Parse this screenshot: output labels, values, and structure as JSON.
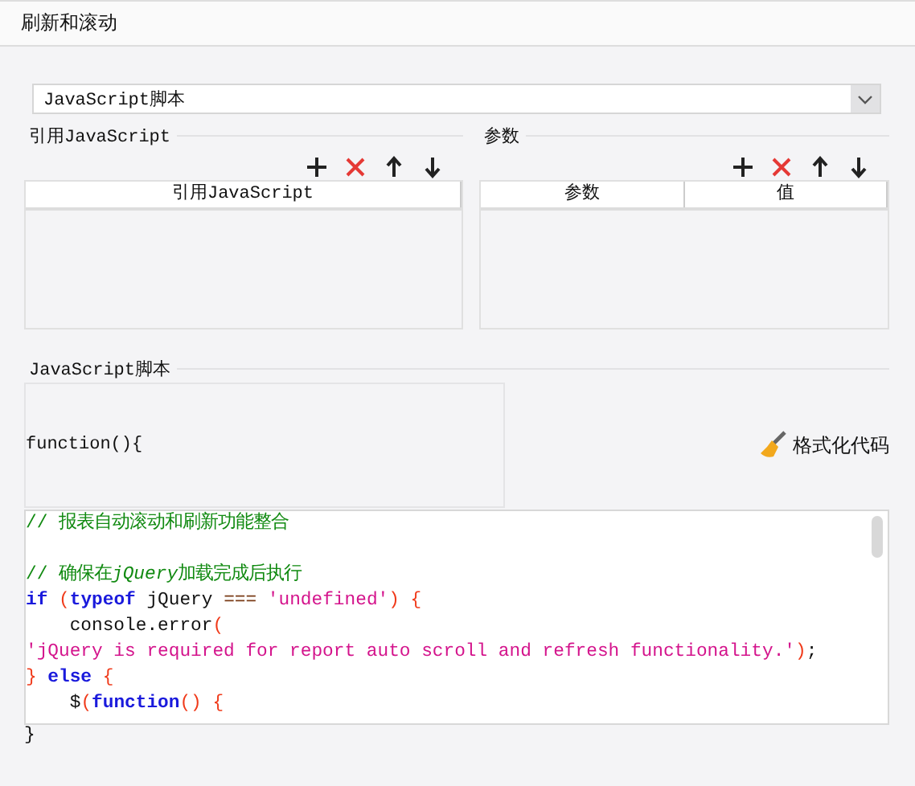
{
  "header": {
    "title": "刷新和滚动"
  },
  "script_type": {
    "value": "JavaScript脚本"
  },
  "references": {
    "title": "引用JavaScript",
    "columns": [
      "引用JavaScript"
    ]
  },
  "parameters": {
    "title": "参数",
    "columns": [
      "参数",
      "值"
    ]
  },
  "script": {
    "title": "JavaScript脚本",
    "signature": "function(){",
    "format_button": "格式化代码",
    "closing": "}",
    "lines": [
      {
        "kind": "code",
        "tokens": [
          {
            "kind": "comment",
            "text": "// 报表自动滚动和刷新功能整合"
          }
        ]
      },
      {
        "kind": "blank"
      },
      {
        "kind": "code",
        "tokens": [
          {
            "kind": "comment",
            "text": "// 确保在"
          },
          {
            "kind": "comment-italic",
            "text": "jQuery"
          },
          {
            "kind": "comment",
            "text": "加载完成后执行"
          }
        ]
      },
      {
        "kind": "code",
        "tokens": [
          {
            "kind": "keyword",
            "text": "if "
          },
          {
            "kind": "punct",
            "text": "("
          },
          {
            "kind": "keyword",
            "text": "typeof "
          },
          {
            "kind": "plain",
            "text": "jQuery "
          },
          {
            "kind": "operator",
            "text": "=== "
          },
          {
            "kind": "string",
            "text": "'undefined'"
          },
          {
            "kind": "punct",
            "text": ") {"
          }
        ]
      },
      {
        "kind": "code",
        "tokens": [
          {
            "kind": "plain",
            "text": "    console.error"
          },
          {
            "kind": "punct",
            "text": "("
          }
        ]
      },
      {
        "kind": "code",
        "tokens": [
          {
            "kind": "string",
            "text": "'jQuery is required for report auto scroll and refresh functionality.'"
          },
          {
            "kind": "punct",
            "text": ")"
          },
          {
            "kind": "plain",
            "text": ";"
          }
        ]
      },
      {
        "kind": "code",
        "tokens": [
          {
            "kind": "punct",
            "text": "} "
          },
          {
            "kind": "keyword",
            "text": "else "
          },
          {
            "kind": "punct",
            "text": "{"
          }
        ]
      },
      {
        "kind": "code",
        "tokens": [
          {
            "kind": "plain",
            "text": "    $"
          },
          {
            "kind": "punct",
            "text": "("
          },
          {
            "kind": "keyword",
            "text": "function"
          },
          {
            "kind": "punct",
            "text": "() {"
          }
        ]
      }
    ]
  }
}
